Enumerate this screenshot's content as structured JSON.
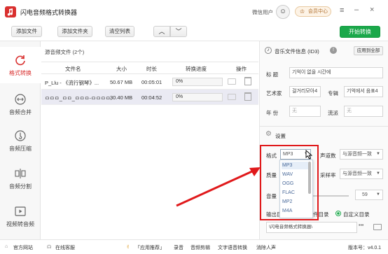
{
  "app": {
    "title": "闪电音频格式转换器",
    "user": "微信用户",
    "vip": "会员中心"
  },
  "toolbar": {
    "add_file": "添加文件",
    "add_folder": "添加文件夹",
    "clear_list": "清空列表",
    "start": "开始转换"
  },
  "sidebar": {
    "items": [
      {
        "label": "格式转换",
        "icon": "refresh-icon"
      },
      {
        "label": "音频合并",
        "icon": "merge-icon"
      },
      {
        "label": "音频压缩",
        "icon": "compress-icon"
      },
      {
        "label": "音频分割",
        "icon": "split-icon"
      },
      {
        "label": "视频转音频",
        "icon": "video-icon"
      }
    ]
  },
  "filelist": {
    "source_label": "源音频文件 (2个)",
    "columns": [
      "文件名",
      "大小",
      "时长",
      "转换进度",
      "操作"
    ],
    "rows": [
      {
        "name": "P_Llu - 《流行钢琴》...",
        "size": "50.67 MB",
        "duration": "00:05:01",
        "progress": "0%"
      },
      {
        "name": "ㅁㅁㅁ_ㅁㅁ_ㅁㅁㅁ-ㅁㅁㅁㅁ...",
        "size": "30.40 MB",
        "duration": "00:04:52",
        "progress": "0%"
      }
    ]
  },
  "info": {
    "title": "音乐文件信息 (ID3)",
    "apply_all": "应用到全部",
    "title_label": "标  题",
    "title_value": "기억이 없을 시간에",
    "artist_label": "艺术家",
    "artist_value": "걸거리모아4",
    "album_label": "专辑",
    "album_value": "기억에서 음표4",
    "year_label": "年  份",
    "year_value": "无",
    "genre_label": "流派",
    "genre_value": "无"
  },
  "settings": {
    "title": "设置",
    "format_label": "格式",
    "format_value": "MP3",
    "format_options": [
      "MP3",
      "WAV",
      "OGG",
      "FLAC",
      "MP2",
      "M4A"
    ],
    "channel_label": "声道数",
    "channel_value": "与源音频一致",
    "quality_label": "质量",
    "samplerate_label": "采样率",
    "samplerate_value": "与源音频一致",
    "volume_label": "音量",
    "volume_value": "59",
    "output_label": "输出目",
    "source_dir_suffix": "件目录",
    "custom_dir": "自定义目录",
    "path": "\\闪电音频格式转换器\\",
    "dots": "•••"
  },
  "statusbar": {
    "website": "官方网站",
    "help": "在线客服",
    "recommend": "「应用推荐」",
    "items": [
      "录音",
      "音频剪辑",
      "文字语音转换",
      "消除人声"
    ],
    "version": "版本号：v4.0.1"
  },
  "colors": {
    "brand": "#d9302f",
    "green": "#1aa84a",
    "annotation": "#e0191b"
  }
}
